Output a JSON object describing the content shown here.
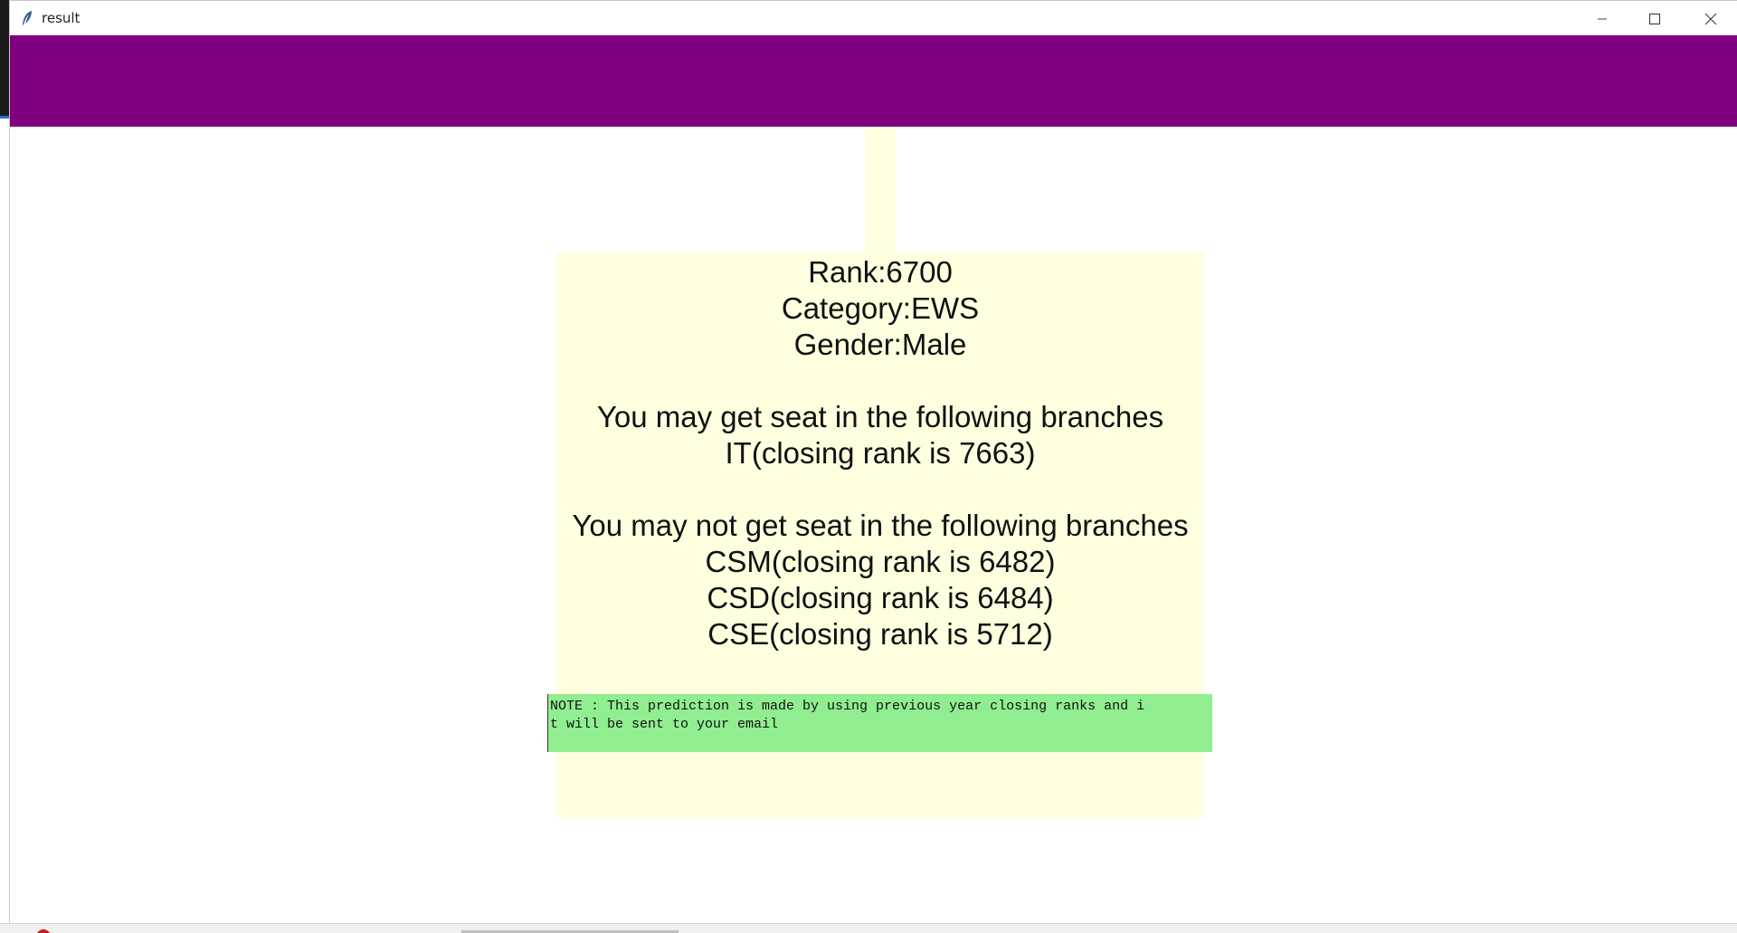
{
  "window": {
    "title": "result",
    "header_color": "#800080",
    "icons": {
      "app": "feather-icon",
      "minimize": "minimize-icon",
      "maximize": "maximize-icon",
      "close": "close-icon"
    }
  },
  "result": {
    "lines": [
      "Rank:6700",
      "Category:EWS",
      "Gender:Male",
      "",
      "You may get seat in the following branches",
      "IT(closing rank is 7663)",
      "",
      "You may not get seat in the following branches",
      "CSM(closing rank is 6482)",
      "CSD(closing rank is 6484)",
      "CSE(closing rank is 5712)"
    ],
    "background": "#ffffe0"
  },
  "note": {
    "lines": [
      "NOTE : This prediction is made by using previous year closing ranks and i",
      "t will be sent to your email"
    ],
    "background": "#90ee90"
  }
}
